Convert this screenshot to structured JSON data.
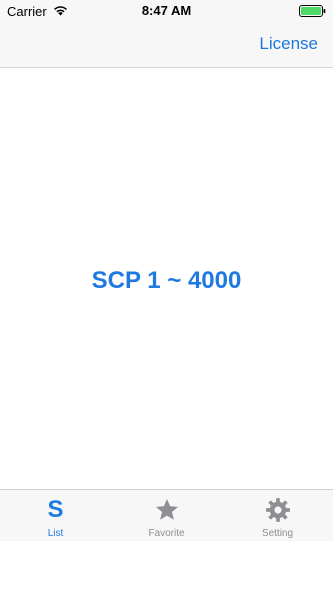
{
  "status_bar": {
    "carrier": "Carrier",
    "time": "8:47 AM",
    "wifi_icon": "wifi-icon",
    "battery_icon": "battery-icon"
  },
  "nav_bar": {
    "right_button_label": "License"
  },
  "main": {
    "title": "SCP 1 ~ 4000"
  },
  "tab_bar": {
    "items": [
      {
        "glyph": "S",
        "label": "List",
        "active": true,
        "icon": "s-letter-icon"
      },
      {
        "label": "Favorite",
        "active": false,
        "icon": "star-icon"
      },
      {
        "label": "Setting",
        "active": false,
        "icon": "gear-icon"
      }
    ]
  },
  "colors": {
    "accent": "#1e7ae0",
    "inactive": "#8e8e93",
    "bar_background": "#f7f7f8"
  }
}
